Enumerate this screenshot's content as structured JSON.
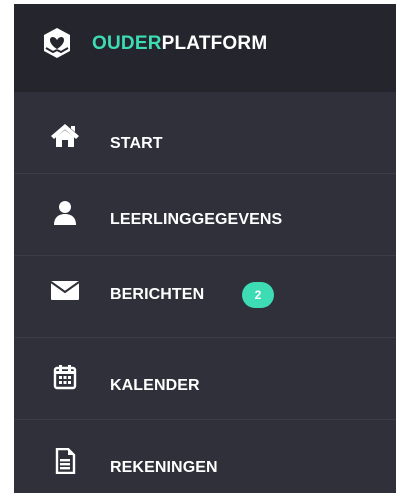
{
  "brand": {
    "logo_icon": "heart-hands-logo-icon",
    "name_accent": "OUDER",
    "name_rest": "PLATFORM"
  },
  "colors": {
    "sidebar_bg": "#2f3039",
    "header_bg": "#25262d",
    "accent": "#3ddcb4",
    "text": "#ffffff"
  },
  "menu": {
    "items": [
      {
        "label": "START",
        "icon": "home-icon"
      },
      {
        "label": "LEERLINGGEGEVENS",
        "icon": "user-icon"
      },
      {
        "label": "BERICHTEN",
        "icon": "envelope-icon",
        "badge": "2"
      },
      {
        "label": "KALENDER",
        "icon": "calendar-icon"
      },
      {
        "label": "REKENINGEN",
        "icon": "invoice-icon"
      }
    ]
  }
}
